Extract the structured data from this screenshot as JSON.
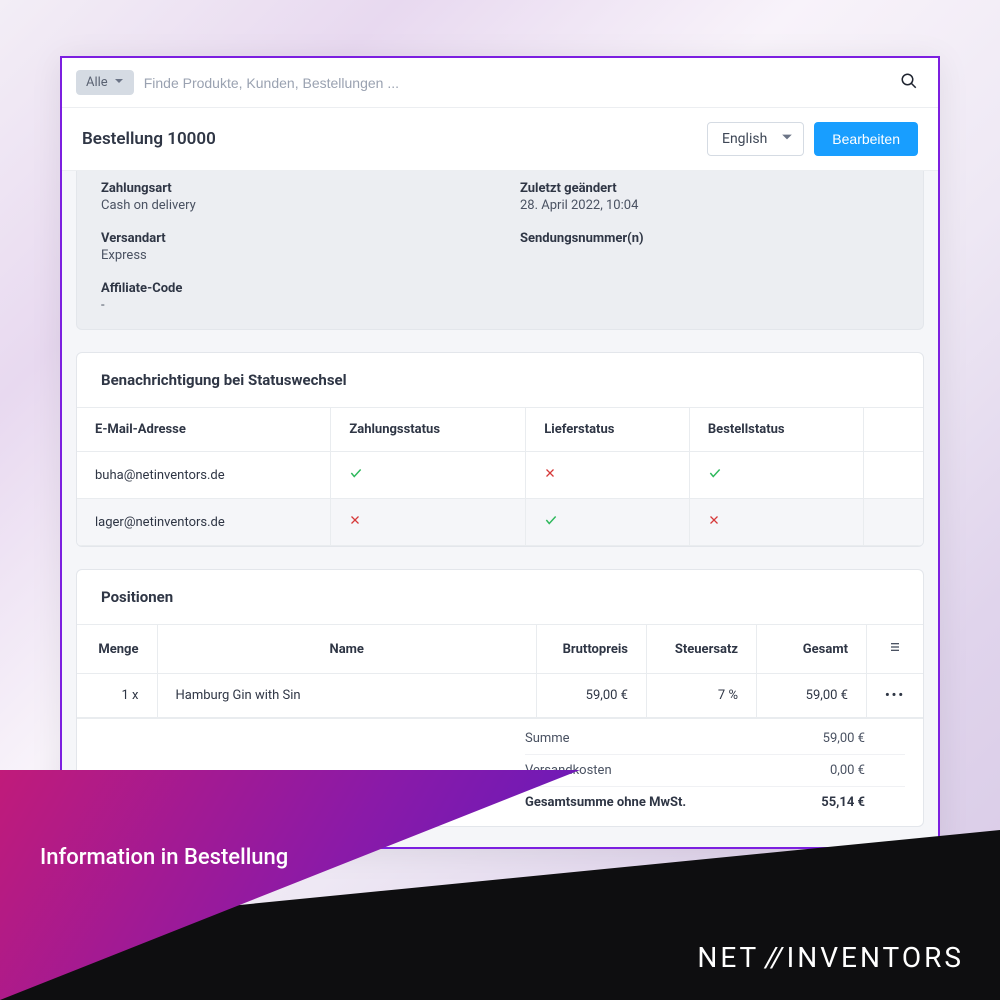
{
  "search": {
    "filter_label": "Alle",
    "placeholder": "Finde Produkte, Kunden, Bestellungen ..."
  },
  "header": {
    "title": "Bestellung 10000",
    "language": "English",
    "edit_label": "Bearbeiten"
  },
  "details": {
    "payment_method": {
      "label": "Zahlungsart",
      "value": "Cash on delivery"
    },
    "shipping_method": {
      "label": "Versandart",
      "value": "Express"
    },
    "affiliate": {
      "label": "Affiliate-Code",
      "value": "-"
    },
    "last_modified": {
      "label": "Zuletzt geändert",
      "value": "28. April 2022, 10:04"
    },
    "tracking": {
      "label": "Sendungsnummer(n)",
      "value": ""
    }
  },
  "notifications": {
    "title": "Benachrichtigung bei Statuswechsel",
    "columns": {
      "email": "E-Mail-Adresse",
      "payment": "Zahlungsstatus",
      "delivery": "Lieferstatus",
      "order": "Bestellstatus"
    },
    "rows": [
      {
        "email": "buha@netinventors.de",
        "payment": true,
        "delivery": false,
        "order": true
      },
      {
        "email": "lager@netinventors.de",
        "payment": false,
        "delivery": true,
        "order": false
      }
    ]
  },
  "positions": {
    "title": "Positionen",
    "columns": {
      "qty": "Menge",
      "name": "Name",
      "gross": "Bruttopreis",
      "tax": "Steuersatz",
      "total": "Gesamt"
    },
    "rows": [
      {
        "qty": "1 x",
        "name": "Hamburg Gin with Sin",
        "gross": "59,00 €",
        "tax": "7 %",
        "total": "59,00 €"
      }
    ],
    "totals": {
      "sum": {
        "label": "Summe",
        "value": "59,00 €"
      },
      "shipping": {
        "label": "Versandkosten",
        "value": "0,00 €"
      },
      "net": {
        "label": "Gesamtsumme ohne MwSt.",
        "value": "55,14 €"
      }
    }
  },
  "banner": {
    "caption": "Information in Bestellung",
    "brand_left": "NET",
    "brand_slashes": "//",
    "brand_right": "INVENTORS"
  }
}
